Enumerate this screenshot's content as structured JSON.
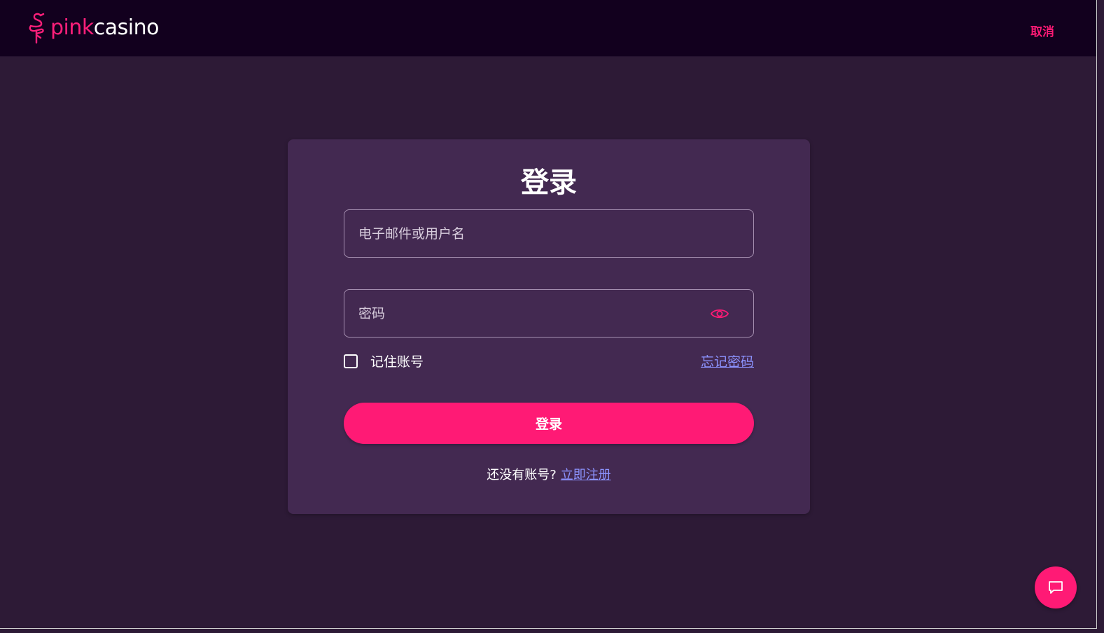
{
  "header": {
    "logo": {
      "pink": "pink",
      "casino": "casino",
      "icon": "flamingo-icon"
    },
    "cancel_label": "取消"
  },
  "login_form": {
    "title": "登录",
    "email_placeholder": "电子邮件或用户名",
    "email_value": "",
    "password_placeholder": "密码",
    "password_value": "",
    "password_toggle_icon": "eye-icon",
    "remember_label": "记住账号",
    "remember_checked": false,
    "forgot_label": "忘记密码",
    "submit_label": "登录",
    "signup_prompt": "还没有账号?",
    "signup_link": "立即注册"
  },
  "chat": {
    "icon": "chat-bubble-icon"
  },
  "colors": {
    "accent": "#ff1a75",
    "link": "#8c93ff",
    "topbar": "#12001e",
    "background": "#2d1a36",
    "card": "#432951"
  }
}
